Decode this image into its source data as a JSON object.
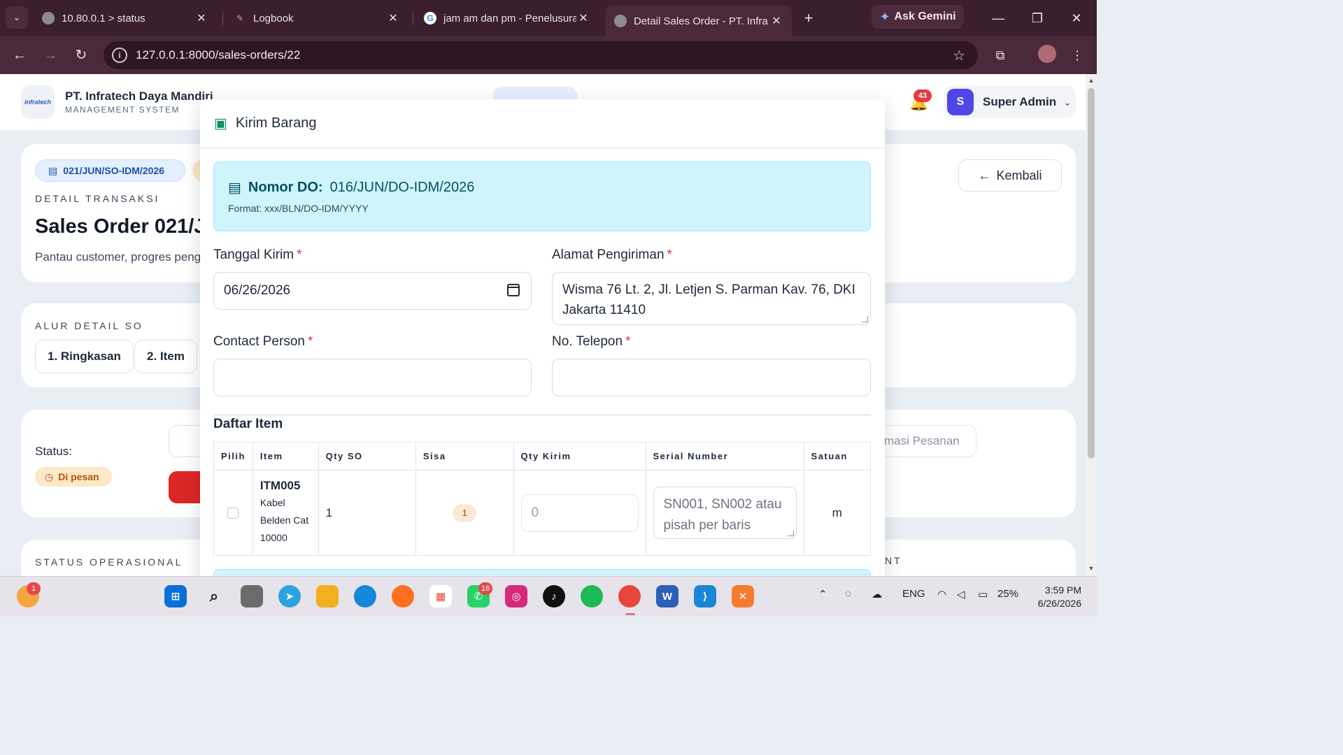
{
  "browser": {
    "tabs": [
      {
        "title": "10.80.0.1 > status",
        "close": "✕"
      },
      {
        "title": "Logbook",
        "close": "✕"
      },
      {
        "title": "jam am dan pm - Penelusuran",
        "close": "✕"
      },
      {
        "title": "Detail Sales Order - PT. Infra",
        "close": "✕"
      }
    ],
    "new_tab": "+",
    "gemini_label": "Ask Gemini",
    "url": "127.0.0.1:8000/sales-orders/22"
  },
  "header": {
    "logo_text": "infratech",
    "company_name": "PT. Infratech Daya Mandiri",
    "company_sub": "MANAGEMENT SYSTEM",
    "notification_count": "43",
    "user_initial": "S",
    "user_name": "Super Admin"
  },
  "page": {
    "doc_chip": "021/JUN/SO-IDM/2026",
    "overline": "DETAIL TRANSAKSI",
    "title": "Sales Order 021/JU",
    "subtitle": "Pantau customer, progres peng",
    "back_label": "Kembali",
    "flow_overline": "ALUR DETAIL SO",
    "steps": [
      "1. Ringkasan",
      "2. Item"
    ],
    "status_label": "Status:",
    "status_value": "Di pesan",
    "confirm_peek": "masi Pesanan",
    "ops_overline": "STATUS OPERASIONAL",
    "ops_peek_right": "NT"
  },
  "modal": {
    "title": "Kirim Barang",
    "do_label": "Nomor DO:",
    "do_number": "016/JUN/DO-IDM/2026",
    "do_format": "Format: xxx/BLN/DO-IDM/YYYY",
    "fields": {
      "tanggal_label": "Tanggal Kirim",
      "tanggal_value": "06/26/2026",
      "alamat_label": "Alamat Pengiriman",
      "alamat_value": "Wisma 76 Lt. 2, Jl. Letjen S. Parman Kav. 76, DKI Jakarta 11410",
      "contact_label": "Contact Person",
      "contact_value": "",
      "telepon_label": "No. Telepon",
      "telepon_value": "",
      "required_mark": "*"
    },
    "items_title": "Daftar Item",
    "table": {
      "headers": [
        "Pilih",
        "Item",
        "Qty SO",
        "Sisa",
        "Qty Kirim",
        "Serial Number",
        "Satuan"
      ],
      "rows": [
        {
          "code": "ITM005",
          "name": "Kabel Belden Cat 10000",
          "qty_so": "1",
          "sisa": "1",
          "qty_kirim_placeholder": "0",
          "serial_placeholder": "SN001, SN002 atau pisah per baris",
          "satuan": "m"
        }
      ]
    }
  },
  "taskbar": {
    "weather_badge": "1",
    "whatsapp_badge": "16",
    "lang": "ENG",
    "battery": "25%",
    "time": "3:59 PM",
    "date": "6/26/2026"
  },
  "colors": {
    "chrome_dark": "#3b1f2e",
    "alert_info": "#cff4fc",
    "danger": "#dc2626",
    "accent": "#4f46e5"
  }
}
